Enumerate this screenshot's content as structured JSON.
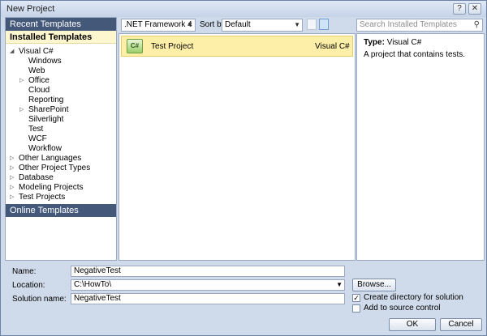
{
  "window": {
    "title": "New Project"
  },
  "title_buttons": {
    "help": "?",
    "close": "✕"
  },
  "left_panel": {
    "recent_templates": "Recent Templates",
    "installed_templates": "Installed Templates",
    "online_templates": "Online Templates",
    "tree": [
      {
        "label": "Visual C#",
        "arrow": "◢"
      },
      {
        "label": "Windows",
        "arrow": ""
      },
      {
        "label": "Web",
        "arrow": ""
      },
      {
        "label": "Office",
        "arrow": "▷"
      },
      {
        "label": "Cloud",
        "arrow": ""
      },
      {
        "label": "Reporting",
        "arrow": ""
      },
      {
        "label": "SharePoint",
        "arrow": "▷"
      },
      {
        "label": "Silverlight",
        "arrow": ""
      },
      {
        "label": "Test",
        "arrow": ""
      },
      {
        "label": "WCF",
        "arrow": ""
      },
      {
        "label": "Workflow",
        "arrow": ""
      },
      {
        "label": "Other Languages",
        "arrow": "▷"
      },
      {
        "label": "Other Project Types",
        "arrow": "▷"
      },
      {
        "label": "Database",
        "arrow": "▷"
      },
      {
        "label": "Modeling Projects",
        "arrow": "▷"
      },
      {
        "label": "Test Projects",
        "arrow": "▷"
      }
    ]
  },
  "toolbar": {
    "framework": ".NET Framework 4",
    "sort_by_label": "Sort by:",
    "sort_value": "Default",
    "search_placeholder": "Search Installed Templates"
  },
  "templates": [
    {
      "name": "Test Project",
      "language": "Visual C#",
      "icon_text": "C#"
    }
  ],
  "details": {
    "type_label": "Type:",
    "type_value": "Visual C#",
    "description": "A project that contains tests."
  },
  "form": {
    "name_label": "Name:",
    "name_value": "NegativeTest",
    "location_label": "Location:",
    "location_value": "C:\\HowTo\\",
    "solution_label": "Solution name:",
    "solution_value": "NegativeTest",
    "browse_label": "Browse...",
    "create_dir_label": "Create directory for solution",
    "create_dir_checked": "✓",
    "source_control_label": "Add to source control",
    "ok_label": "OK",
    "cancel_label": "Cancel"
  }
}
